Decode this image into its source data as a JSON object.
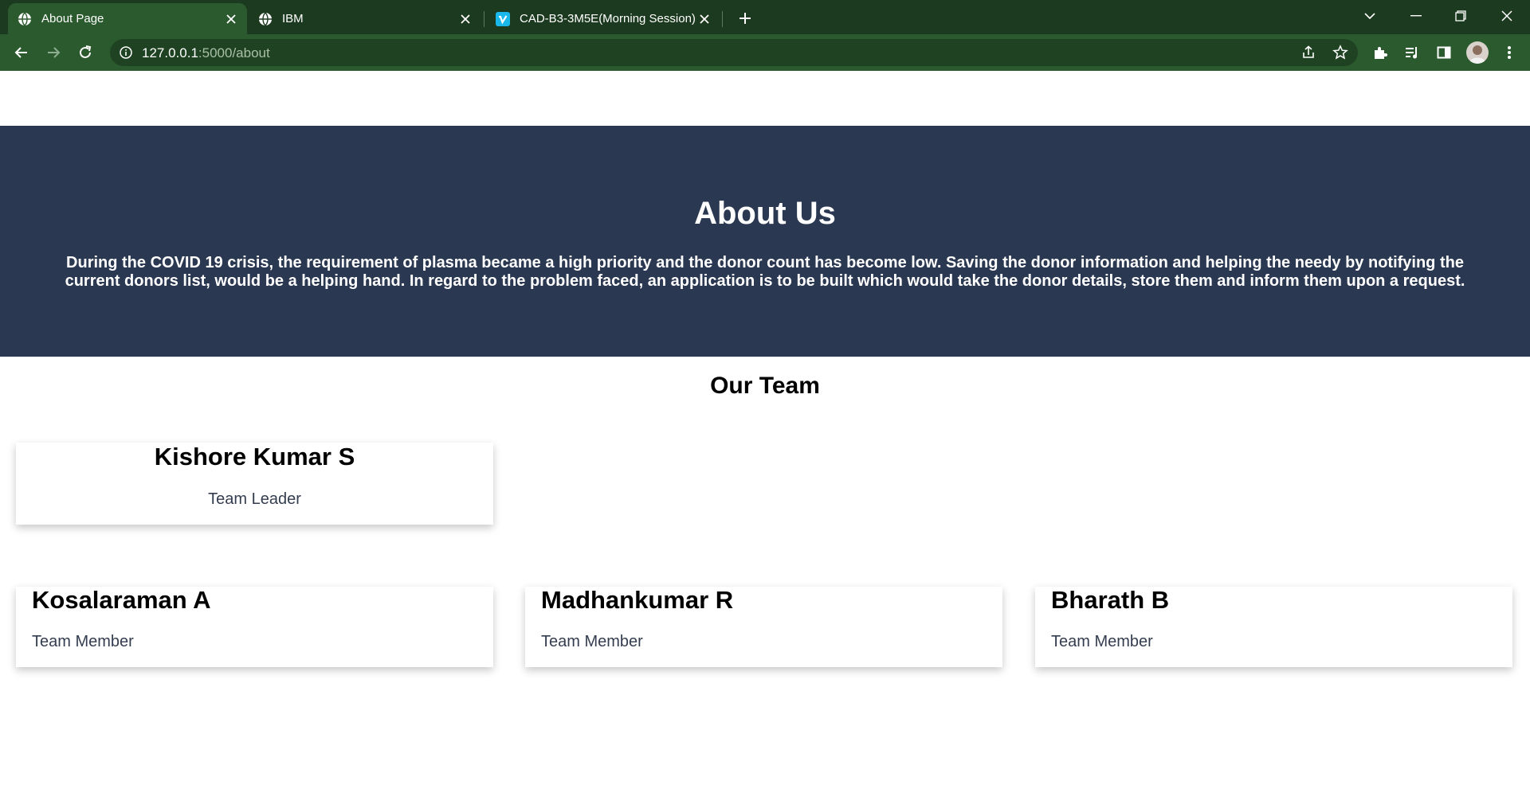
{
  "browser": {
    "tabs": [
      {
        "title": "About Page",
        "icon": "globe-icon",
        "active": true
      },
      {
        "title": "IBM",
        "icon": "globe-icon",
        "active": false
      },
      {
        "title": "CAD-B3-3M5E(Morning Session)",
        "icon": "vimeo-icon",
        "active": false
      }
    ],
    "url_host": "127.0.0.1",
    "url_path": ":5000/about",
    "colors": {
      "frame": "#1c3a1f",
      "toolbar": "#2b5a2e",
      "omnibox": "#1f4322"
    }
  },
  "page": {
    "hero": {
      "title": "About Us",
      "text": "During the COVID 19 crisis, the requirement of plasma became a high priority and the donor count has become low. Saving the donor information and helping the needy by notifying the current donors list, would be a helping hand. In regard to the problem faced, an application is to be built which would take the donor details, store them and inform them upon a request.",
      "background": "#2b3852"
    },
    "team_title": "Our Team",
    "leader": {
      "name": "Kishore Kumar S",
      "role": "Team Leader"
    },
    "members": [
      {
        "name": "Kosalaraman A",
        "role": "Team Member"
      },
      {
        "name": "Madhankumar R",
        "role": "Team Member"
      },
      {
        "name": "Bharath B",
        "role": "Team Member"
      }
    ]
  }
}
